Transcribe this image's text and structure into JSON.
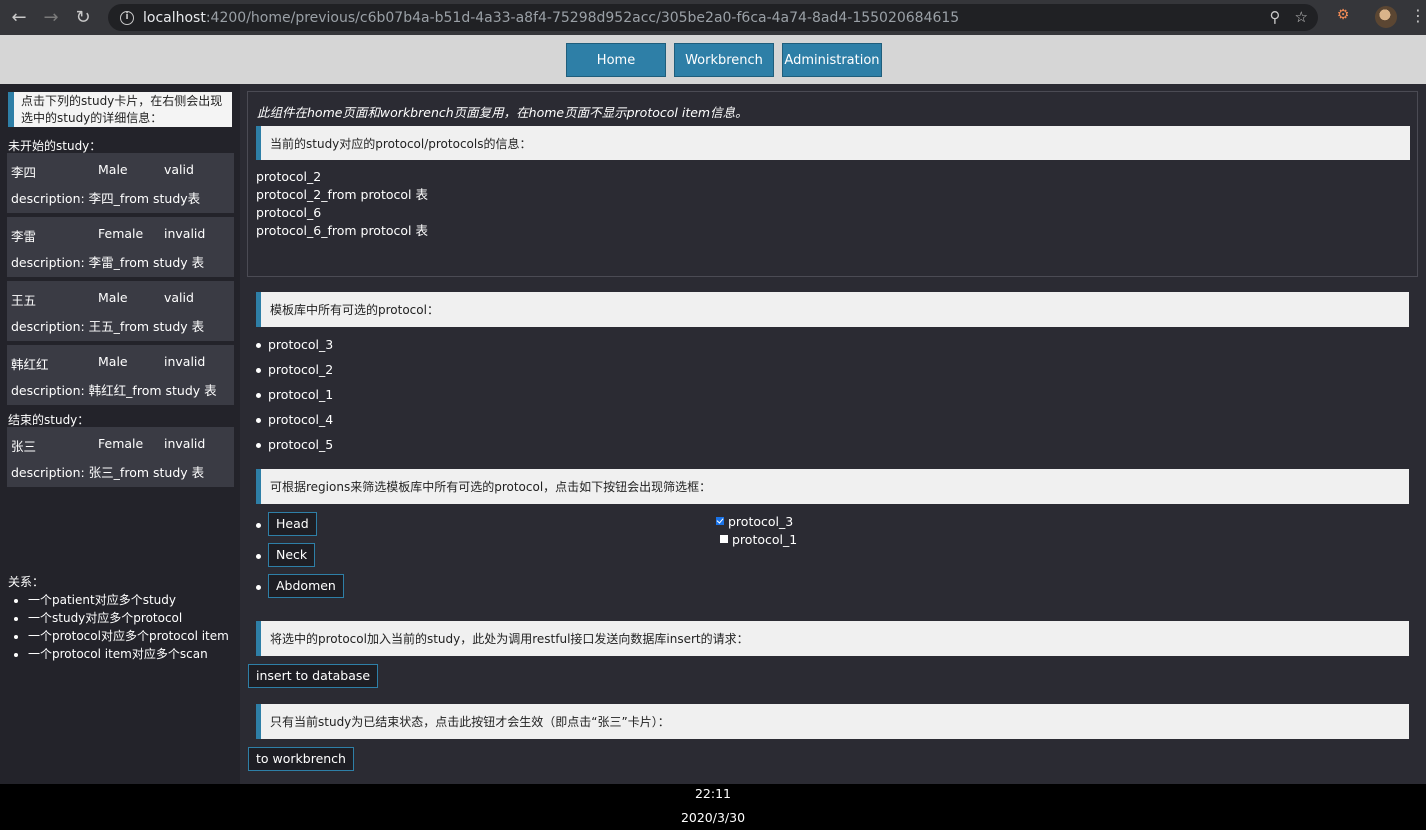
{
  "browser": {
    "url_host": "localhost",
    "url_path": ":4200/home/previous/c6b07b4a-b51d-4a33-a8f4-75298d952acc/305be2a0-f6ca-4a74-8ad4-155020684615",
    "icons": [
      "back-icon",
      "forward-icon",
      "reload-icon",
      "info-icon",
      "zoom-icon",
      "star-icon",
      "extension-icon",
      "profile-avatar",
      "menu-icon"
    ]
  },
  "topnav": {
    "home": "Home",
    "workbrench": "Workbrench",
    "administration": "Administration"
  },
  "sidebar": {
    "intro": "点击下列的study卡片，在右侧会出现选中的study的详细信息：",
    "pending_title": "未开始的study：",
    "pending": [
      {
        "name": "李四",
        "gender": "Male",
        "status": "valid",
        "description": "description: 李四_from study表"
      },
      {
        "name": "李雷",
        "gender": "Female",
        "status": "invalid",
        "description": "description: 李雷_from study 表"
      },
      {
        "name": "王五",
        "gender": "Male",
        "status": "valid",
        "description": "description: 王五_from study 表"
      },
      {
        "name": "韩红红",
        "gender": "Male",
        "status": "invalid",
        "description": "description: 韩红红_from study 表"
      }
    ],
    "finished_title": "结束的study：",
    "finished": [
      {
        "name": "张三",
        "gender": "Female",
        "status": "invalid",
        "description": "description: 张三_from study 表"
      }
    ],
    "relations_title": "关系：",
    "relations": [
      "一个patient对应多个study",
      "一个study对应多个protocol",
      "一个protocol对应多个protocol item",
      "一个protocol item对应多个scan"
    ]
  },
  "main": {
    "note": "此组件在home页面和workbrench页面复用，在home页面不显示protocol item信息。",
    "current_title": "当前的study对应的protocol/protocols的信息：",
    "current_lines": [
      "protocol_2",
      "protocol_2_from protocol 表",
      "protocol_6",
      "protocol_6_from protocol 表"
    ],
    "library_title": "模板库中所有可选的protocol：",
    "library": [
      "protocol_3",
      "protocol_2",
      "protocol_1",
      "protocol_4",
      "protocol_5"
    ],
    "filter_title": "可根据regions来筛选模板库中所有可选的protocol，点击如下按钮会出现筛选框：",
    "regions": [
      "Head",
      "Neck",
      "Abdomen"
    ],
    "filter_options": [
      {
        "label": "protocol_3",
        "checked": true
      },
      {
        "label": "protocol_1",
        "checked": false
      }
    ],
    "insert_title": "将选中的protocol加入当前的study，此处为调用restful接口发送向数据库insert的请求：",
    "insert_button": "insert to database",
    "workbrench_title": "只有当前study为已结束状态，点击此按钮才会生效（即点击“张三”卡片）：",
    "workbrench_button": "to workbrench"
  },
  "footer": {
    "time": "22:11",
    "date": "2020/3/30"
  },
  "colors": {
    "accent": "#2e7fa7",
    "background": "#2b2b33",
    "sidebar": "#23232a",
    "card": "#3a3b44"
  }
}
